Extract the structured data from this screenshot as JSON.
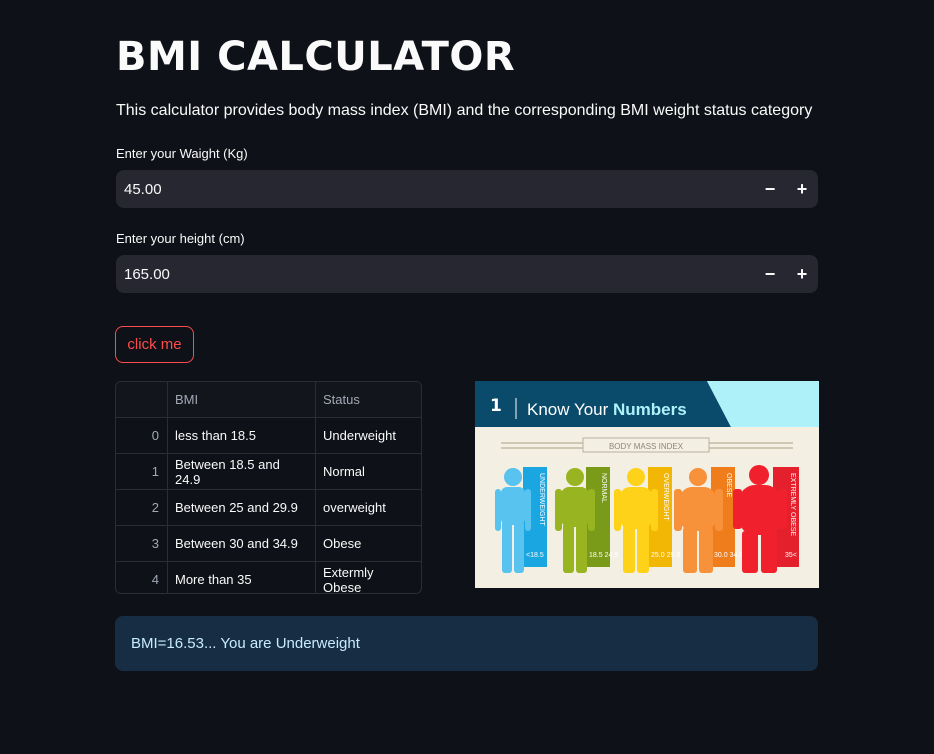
{
  "title": "BMI CALCULATOR",
  "description": "This calculator provides body mass index (BMI) and the corresponding BMI weight status category",
  "weight": {
    "label": "Enter your Waight (Kg)",
    "value": "45.00",
    "minus": "−",
    "plus": "+"
  },
  "height": {
    "label": "Enter your height (cm)",
    "value": "165.00",
    "minus": "−",
    "plus": "+"
  },
  "button": {
    "label": "click me"
  },
  "table": {
    "headers": [
      "",
      "BMI",
      "Status"
    ],
    "rows": [
      {
        "index": "0",
        "bmi": "less than 18.5",
        "status": "Underweight"
      },
      {
        "index": "1",
        "bmi": "Between 18.5 and 24.9",
        "status": "Normal"
      },
      {
        "index": "2",
        "bmi": "Between 25 and 29.9",
        "status": "overweight"
      },
      {
        "index": "3",
        "bmi": "Between 30 and 34.9",
        "status": "Obese"
      },
      {
        "index": "4",
        "bmi": "More than 35",
        "status": "Extermly Obese"
      }
    ]
  },
  "infographic": {
    "header_prefix": "Know Your ",
    "header_emphasis": "Numbers",
    "banner": "BODY MASS INDEX",
    "categories": [
      {
        "label": "UNDERWEIGHT",
        "range": "<18.5",
        "color": "#1aa6e0"
      },
      {
        "label": "NORMAL",
        "range": "18.5 24.9",
        "color": "#7a9a1a"
      },
      {
        "label": "OVERWEIGHT",
        "range": "25.0 29.9",
        "color": "#f2b705"
      },
      {
        "label": "OBESE",
        "range": "30.0 34.9",
        "color": "#ef7d1b"
      },
      {
        "label": "EXTREMLY OBESE",
        "range": "35<",
        "color": "#e3202c"
      }
    ]
  },
  "result": {
    "text": "BMI=16.53... You are Underweight"
  }
}
